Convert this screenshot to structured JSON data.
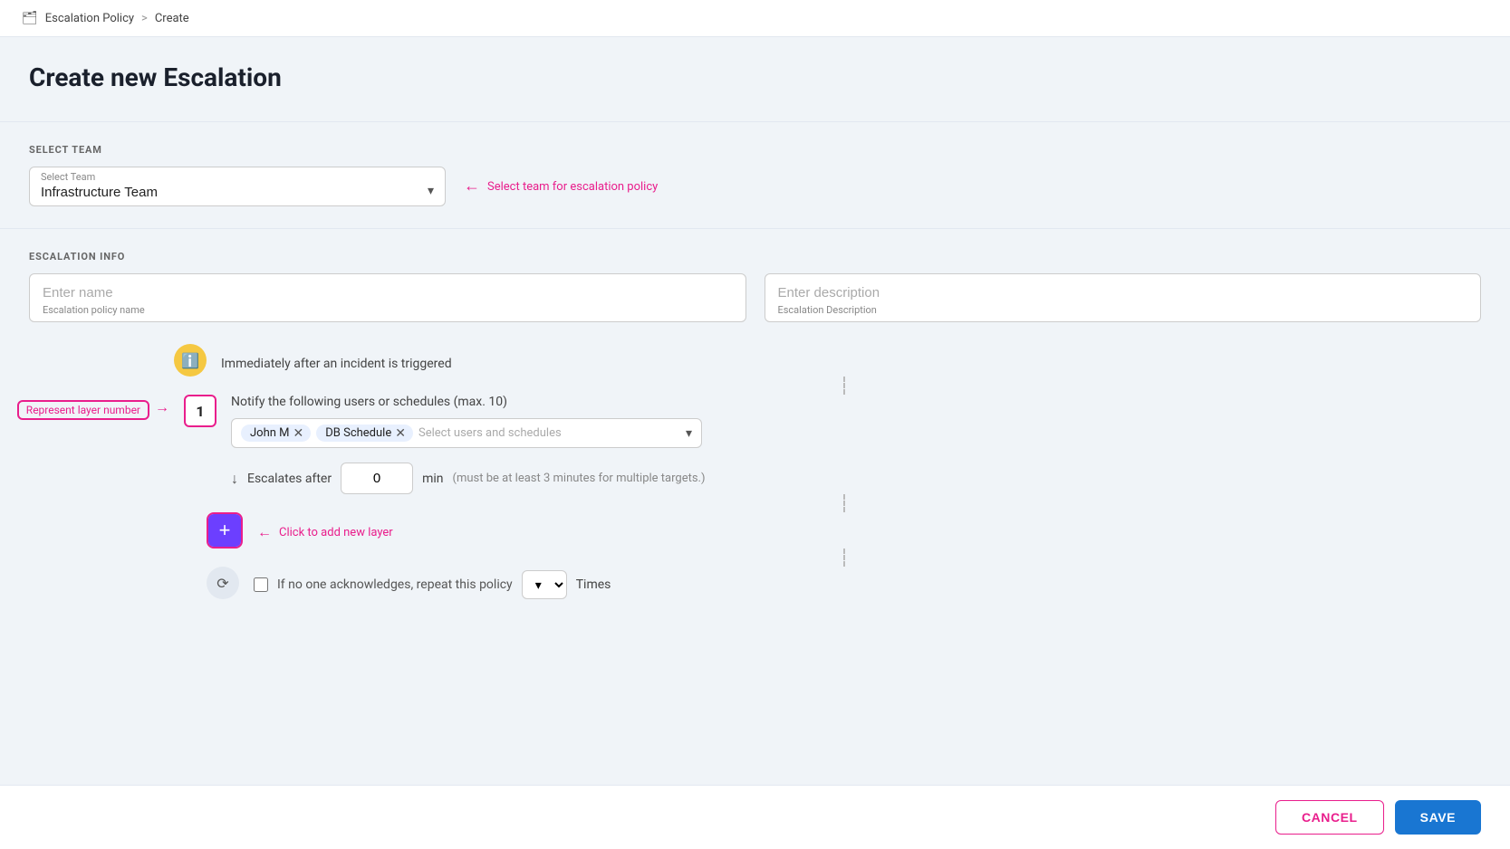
{
  "breadcrumb": {
    "icon": "🗂",
    "parent": "Escalation Policy",
    "separator": ">",
    "current": "Create"
  },
  "page": {
    "title": "Create new Escalation"
  },
  "sections": {
    "select_team": {
      "label": "SELECT TEAM",
      "field_label": "Select Team",
      "selected_value": "Infrastructure Team",
      "annotation": "Select team for escalation policy"
    },
    "escalation_info": {
      "label": "ESCALATION INFO",
      "name_placeholder": "Enter name",
      "name_hint": "Escalation policy name",
      "description_placeholder": "Enter description",
      "description_hint": "Escalation Description"
    }
  },
  "flow": {
    "trigger": {
      "text": "Immediately after an incident is triggered"
    },
    "layer": {
      "number": "1",
      "annotation_label": "Represent layer number",
      "notify_text": "Notify the following users or schedules (max. 10)",
      "tags": [
        {
          "label": "John M"
        },
        {
          "label": "DB Schedule"
        }
      ],
      "tags_placeholder": "Select users and schedules",
      "escalates_after_label": "Escalates after",
      "escalates_value": "0",
      "escalates_unit": "min",
      "escalates_note": "(must be at least 3 minutes for multiple targets.)"
    },
    "add_layer": {
      "label": "+",
      "annotation": "Click to add new layer"
    },
    "repeat": {
      "checkbox_label": "If no one acknowledges, repeat this policy",
      "times_label": "Times"
    }
  },
  "footer": {
    "cancel_label": "CANCEL",
    "save_label": "SAVE"
  }
}
